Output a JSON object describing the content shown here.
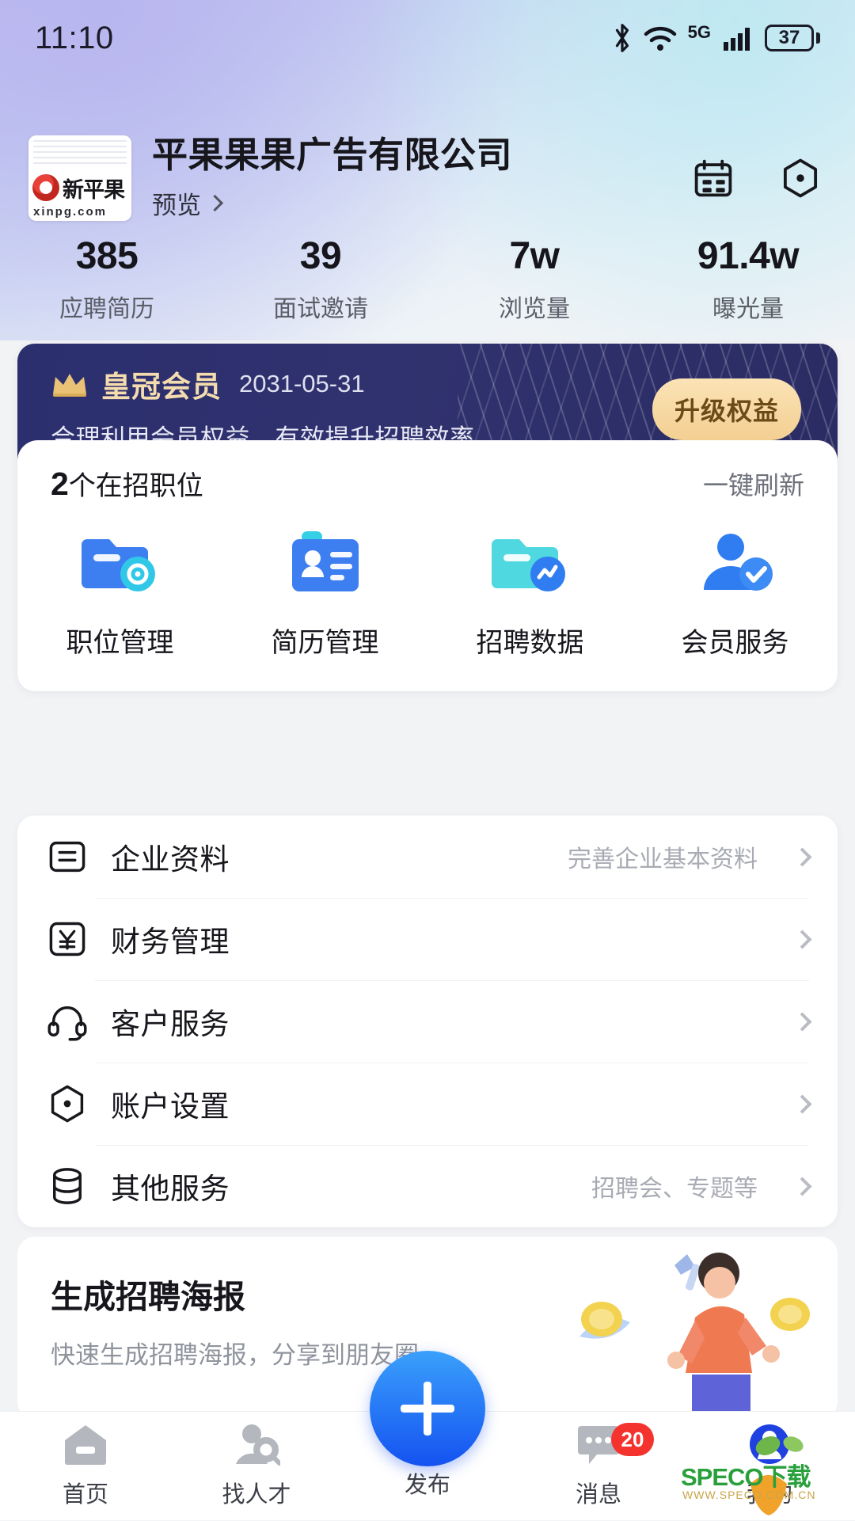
{
  "status_bar": {
    "time": "11:10",
    "battery_level": "37",
    "network": "5G",
    "icons": [
      "bluetooth-icon",
      "wifi-icon",
      "5g-icon",
      "signal-icon",
      "battery-icon"
    ]
  },
  "header": {
    "logo_name": "新平果",
    "logo_domain": "xinpg.com",
    "company_name": "平果果果广告有限公司",
    "preview_label": "预览",
    "icons": [
      "calendar-icon",
      "settings-icon"
    ]
  },
  "stats": [
    {
      "value": "385",
      "label": "应聘简历"
    },
    {
      "value": "39",
      "label": "面试邀请"
    },
    {
      "value": "7w",
      "label": "浏览量"
    },
    {
      "value": "91.4w",
      "label": "曝光量"
    }
  ],
  "vip": {
    "title": "皇冠会员",
    "expiry": "2031-05-31",
    "subtitle": "合理利用会员权益，有效提升招聘效率",
    "upgrade_label": "升级权益",
    "accent_gold": "#f4dcae",
    "bg_navy": "#2e3070"
  },
  "quick": {
    "jobs_count": "2",
    "jobs_suffix": "个在招职位",
    "refresh_label": "一键刷新",
    "items": [
      {
        "label": "职位管理",
        "icon": "job-folder-icon"
      },
      {
        "label": "简历管理",
        "icon": "resume-card-icon"
      },
      {
        "label": "招聘数据",
        "icon": "data-chart-icon"
      },
      {
        "label": "会员服务",
        "icon": "member-check-icon"
      }
    ]
  },
  "menu": [
    {
      "label": "企业资料",
      "hint": "完善企业基本资料",
      "icon": "document-icon"
    },
    {
      "label": "财务管理",
      "hint": "",
      "icon": "yuan-icon"
    },
    {
      "label": "客户服务",
      "hint": "",
      "icon": "headset-icon"
    },
    {
      "label": "账户设置",
      "hint": "",
      "icon": "settings-icon"
    },
    {
      "label": "其他服务",
      "hint": "招聘会、专题等",
      "icon": "database-icon"
    }
  ],
  "poster": {
    "title": "生成招聘海报",
    "subtitle": "快速生成招聘海报，分享到朋友圈"
  },
  "tabbar": {
    "items": [
      {
        "label": "首页",
        "icon": "home-icon",
        "active": true
      },
      {
        "label": "找人才",
        "icon": "talent-search-icon",
        "active": false
      },
      {
        "label": "发布",
        "icon": "plus-icon",
        "active": false
      },
      {
        "label": "消息",
        "icon": "message-icon",
        "active": false,
        "badge": "20"
      },
      {
        "label": "我的",
        "icon": "profile-icon",
        "active": false
      }
    ]
  },
  "watermark": {
    "text": "SPECO下载",
    "sub": "WWW.SPECO.COM.CN"
  }
}
